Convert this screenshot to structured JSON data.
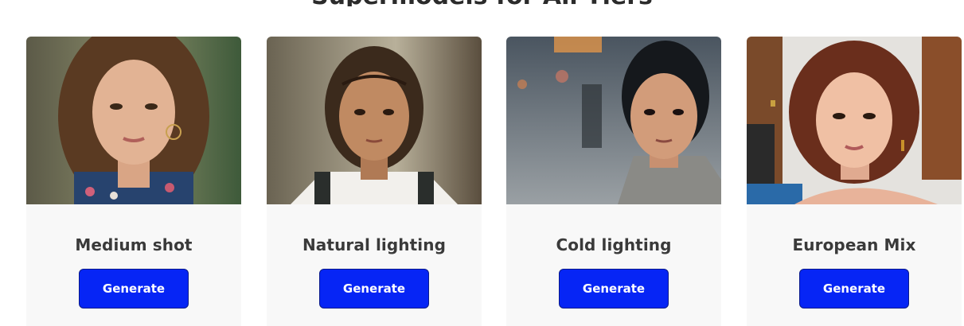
{
  "section": {
    "heading": "Supermodels for All Tiers"
  },
  "cards": [
    {
      "title": "Medium shot",
      "button_label": "Generate",
      "image_alt": "Portrait of a young woman with long brown hair and hoop earrings"
    },
    {
      "title": "Natural lighting",
      "button_label": "Generate",
      "image_alt": "Portrait of a young girl in a school uniform"
    },
    {
      "title": "Cold lighting",
      "button_label": "Generate",
      "image_alt": "Portrait of a woman in a grey coat on a city street"
    },
    {
      "title": "European Mix",
      "button_label": "Generate",
      "image_alt": "Portrait of a young woman with short auburn hair"
    }
  ],
  "colors": {
    "button_bg": "#0625f5",
    "button_border": "#0a1a8a",
    "card_bg": "#f8f8f8",
    "title_text": "#3a3a3a"
  }
}
